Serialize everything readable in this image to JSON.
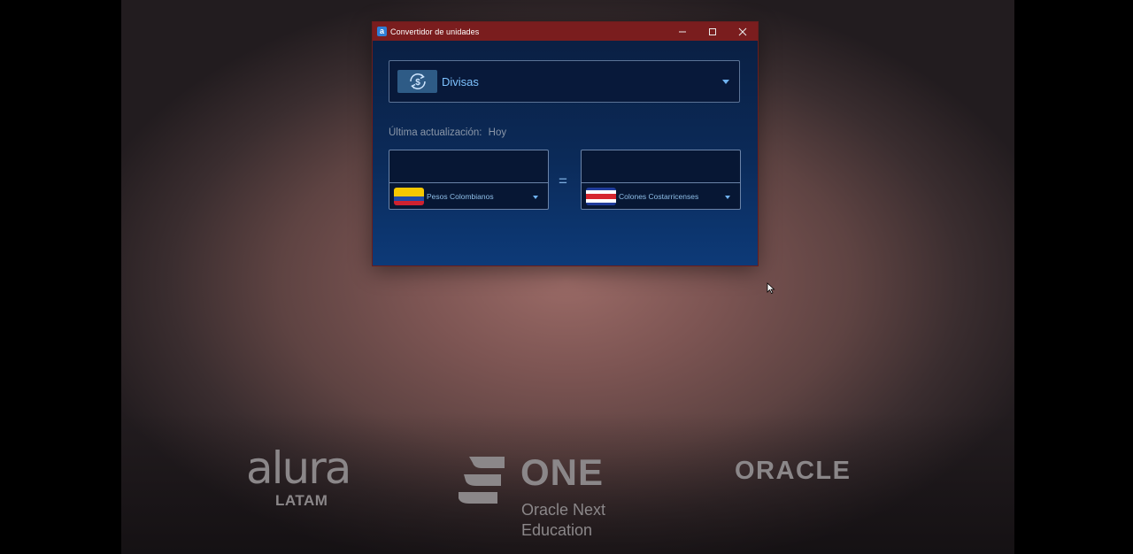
{
  "window": {
    "title": "Convertidor de unidades",
    "app_icon_glyph": "a",
    "controls": [
      "minimize-icon",
      "maximize-icon",
      "close-icon"
    ]
  },
  "converter": {
    "type_select": {
      "value": "Divisas",
      "icon": "currency-exchange-icon"
    },
    "last_update": {
      "label": "Última actualización:",
      "value": "Hoy"
    },
    "from": {
      "amount": "",
      "currency": "Pesos Colombianos",
      "flag": "colombia-flag"
    },
    "to": {
      "amount": "",
      "currency": "Colones Costarricenses",
      "flag": "costa-rica-flag"
    },
    "equals_sign": "="
  },
  "logos": {
    "alura": "alura",
    "alura_sub": "LATAM",
    "one": "ONE",
    "one_line1": "Oracle Next",
    "one_line2": "Education",
    "oracle": "ORACLE"
  },
  "colors": {
    "titlebar": "#7a1d1e",
    "window_bg": "#0b2a58",
    "accent": "#7ec3ff"
  }
}
